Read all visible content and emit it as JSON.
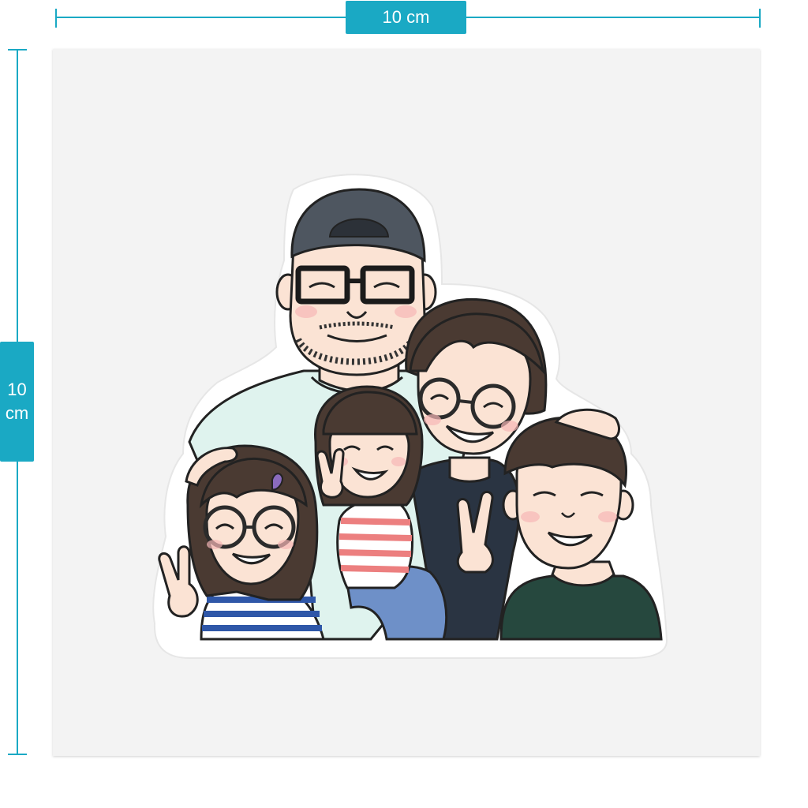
{
  "dimensions": {
    "width_label": "10 cm",
    "height_label_value": "10",
    "height_label_unit": "cm"
  },
  "colors": {
    "accent": "#1aa9c4",
    "card_background": "#f3f3f3",
    "skin": "#fbe3d4",
    "hair": "#4a3a32",
    "cap": "#4e5660",
    "dad_shirt": "#dff3ee",
    "mom_top": "#2a3442",
    "boy_shirt": "#26483e",
    "striped_shirt_blue": "#2f57a8",
    "striped_shirt_red": "#ec7f7f",
    "jeans": "#6e90c8"
  },
  "artwork": {
    "subject": "family-sticker-illustration",
    "figures": [
      "father-with-cap-and-glasses",
      "mother-with-glasses",
      "girl-with-glasses",
      "little-girl",
      "boy"
    ]
  }
}
